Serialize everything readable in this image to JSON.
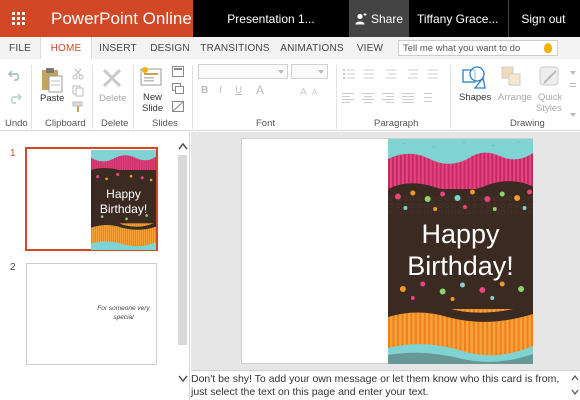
{
  "app": {
    "name": "PowerPoint Online",
    "document_title": "Presentation 1...",
    "share_label": "Share",
    "user_name": "Tiffany Grace...",
    "sign_out_label": "Sign out"
  },
  "ribbon_tabs": [
    "FILE",
    "HOME",
    "INSERT",
    "DESIGN",
    "TRANSITIONS",
    "ANIMATIONS",
    "VIEW"
  ],
  "active_tab": "HOME",
  "tell_me": {
    "placeholder": "Tell me what you want to do"
  },
  "ribbon": {
    "groups": {
      "undo": "Undo",
      "clipboard": "Clipboard",
      "delete": "Delete",
      "slides": "Slides",
      "font": "Font",
      "paragraph": "Paragraph",
      "drawing": "Drawing"
    },
    "buttons": {
      "paste": "Paste",
      "delete": "Delete",
      "new_slide_line1": "New",
      "new_slide_line2": "Slide",
      "shapes": "Shapes",
      "arrange": "Arrange",
      "quick_styles_line1": "Quick",
      "quick_styles_line2": "Styles"
    },
    "format_glyphs": {
      "bold": "B",
      "italic": "I",
      "underline": "U",
      "font_color": "A"
    }
  },
  "slides": [
    {
      "number": "1",
      "text_line1": "Happy",
      "text_line2": "Birthday!",
      "selected": true
    },
    {
      "number": "2",
      "text_line1": "For someone very",
      "text_line2": "special",
      "selected": false
    }
  ],
  "main_slide": {
    "text_line1": "Happy",
    "text_line2": "Birthday!"
  },
  "notes": {
    "text": "Don't be shy! To add your own message or let them know who this card is from, just select the text on this page and enter your text."
  },
  "colors": {
    "brand": "#d24726",
    "cake_brown": "#3b2a22",
    "pink": "#e8457f",
    "teal": "#7fd3d3",
    "orange": "#f39a26"
  }
}
